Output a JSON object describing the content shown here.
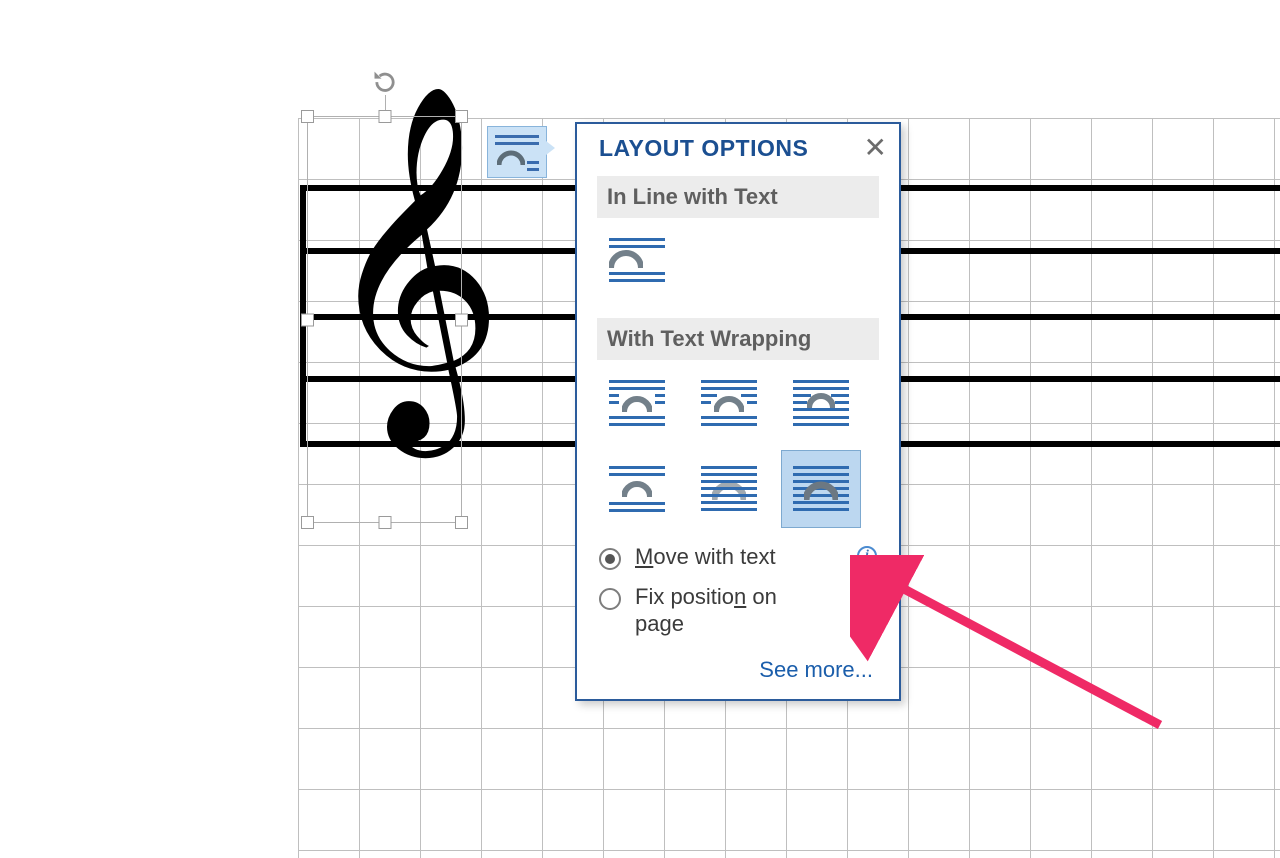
{
  "panel": {
    "title": "LAYOUT OPTIONS",
    "section_inline": "In Line with Text",
    "section_wrap": "With Text Wrapping",
    "options": {
      "inline": "in-line-with-text",
      "wrap": [
        "square",
        "tight",
        "through",
        "top-bottom",
        "behind-text",
        "in-front-of-text"
      ]
    },
    "selected_option": "in-front-of-text",
    "radios": {
      "move": {
        "pre": "",
        "u": "M",
        "post": "ove with text",
        "checked": true
      },
      "fix": {
        "pre": "Fix positio",
        "u": "n",
        "post": " on page",
        "checked": false
      }
    },
    "see_more": "See more..."
  },
  "glyphs": {
    "close": "✕",
    "clef": "𝄞"
  }
}
